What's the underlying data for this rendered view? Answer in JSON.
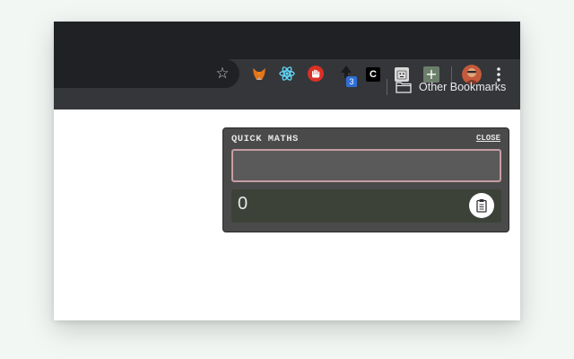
{
  "browser": {
    "toolbar": {
      "icons": [
        "star-icon",
        "metamask-fox-icon",
        "react-atom-icon",
        "red-hand-icon",
        "upload-arrow-icon",
        "c-icon",
        "robot-icon",
        "plus-icon",
        "avatar",
        "vertical-dots-icon"
      ],
      "extension_badge": "3",
      "c_label": "C",
      "plus_label": "+"
    },
    "bookmarks": {
      "other_label": "Other Bookmarks"
    }
  },
  "popup": {
    "title": "QUICK MATHS",
    "close_label": "CLOSE",
    "input_value": "",
    "result": "0",
    "colors": {
      "background": "#4a4a4a",
      "input_border": "#c89ca4",
      "result_background": "#3d4239"
    }
  }
}
